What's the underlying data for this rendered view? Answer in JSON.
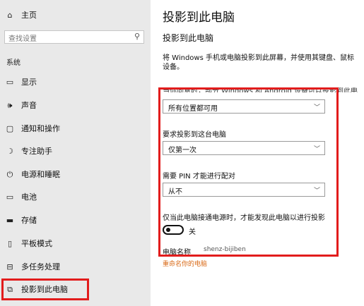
{
  "sidebar": {
    "home_label": "主页",
    "search_placeholder": "查找设置",
    "section_label": "系统",
    "items": [
      {
        "label": "显示",
        "icon": "monitor-icon"
      },
      {
        "label": "声音",
        "icon": "speaker-icon"
      },
      {
        "label": "通知和操作",
        "icon": "notification-icon"
      },
      {
        "label": "专注助手",
        "icon": "moon-icon"
      },
      {
        "label": "电源和睡眠",
        "icon": "power-icon"
      },
      {
        "label": "电池",
        "icon": "battery-icon"
      },
      {
        "label": "存储",
        "icon": "storage-icon"
      },
      {
        "label": "平板模式",
        "icon": "tablet-icon"
      },
      {
        "label": "多任务处理",
        "icon": "multitask-icon"
      },
      {
        "label": "投影到此电脑",
        "icon": "project-icon"
      }
    ]
  },
  "main": {
    "title": "投影到此电脑",
    "subtitle": "投影到此电脑",
    "description_line1": "将 Windows 手机或电脑投影到此屏幕，并使用其键盘、鼠标",
    "description_line2": "设备。",
    "cutoff_label": "当你同意时，部分 Windows 和 Android 设备可以投影到此电脑",
    "availability_value": "所有位置都可用",
    "request_label": "要求投影到这台电脑",
    "request_value": "仅第一次",
    "pin_label": "需要 PIN 才能进行配对",
    "pin_value": "从不",
    "power_label": "仅当此电脑接通电源时，才能发现此电脑以进行投影",
    "toggle_state": "关",
    "pc_name_label": "电脑名称",
    "pc_name_value": "shenz-bijiben",
    "rename_link": "重命名你的电脑"
  },
  "colors": {
    "highlight": "#e21c1c",
    "link": "#d96a17",
    "sidebar_bg": "#e9e9e9"
  }
}
